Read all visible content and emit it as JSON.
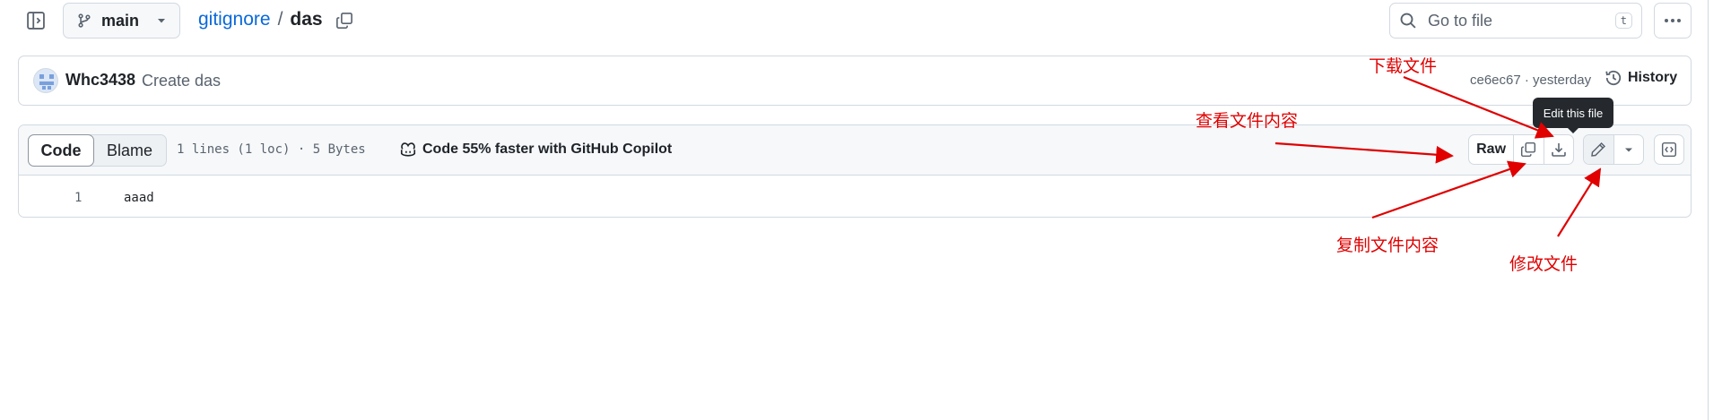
{
  "header": {
    "branch": "main",
    "breadcrumb_repo": "gitignore",
    "breadcrumb_sep": "/",
    "breadcrumb_file": "das",
    "goto_placeholder": "Go to file",
    "goto_shortcut": "t"
  },
  "commit": {
    "author": "Whc3438",
    "message": "Create das",
    "meta": "ce6ec67 · yesterday",
    "history_label": "History"
  },
  "file_view": {
    "tab_code": "Code",
    "tab_blame": "Blame",
    "lines_info": "1 lines (1 loc) · 5 Bytes",
    "copilot_text": "Code 55% faster with GitHub Copilot",
    "raw_label": "Raw",
    "tooltip": "Edit this file"
  },
  "code": {
    "lines": [
      {
        "number": "1",
        "text": "aaad"
      }
    ]
  },
  "annotations": {
    "download": "下载文件",
    "view": "查看文件内容",
    "copy": "复制文件内容",
    "edit": "修改文件"
  },
  "colors": {
    "link": "#0969da",
    "annotation": "#e00000",
    "border": "#d1d9e0",
    "header_bg": "#f6f8fa"
  },
  "icons": [
    "sidebar-toggle-icon",
    "branch-icon",
    "chevron-down-icon",
    "copy-path-icon",
    "search-icon",
    "kebab-icon",
    "history-icon",
    "copilot-icon",
    "copy-icon",
    "download-icon",
    "pencil-icon",
    "symbols-icon"
  ]
}
